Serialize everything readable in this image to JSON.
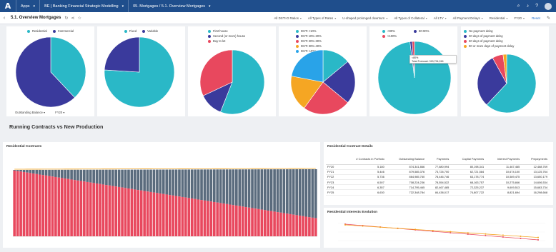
{
  "topbar": {
    "logo": "A",
    "crumbs": [
      {
        "label": "Apps"
      },
      {
        "label": "BE | Banking Financial Strategic Modelling"
      },
      {
        "label": "05. Mortgages / 5.1. Overview Mortgages"
      }
    ],
    "icons": [
      "search-icon",
      "bell-icon",
      "help-icon",
      "avatar"
    ]
  },
  "subbar": {
    "back": "‹",
    "title": "5.1. Overview Mortgages",
    "title_icons": [
      "refresh-icon",
      "share-icon",
      "star-icon"
    ],
    "filters": [
      {
        "label": "All DSTI-D Ratios"
      },
      {
        "label": "All Types of Rates"
      },
      {
        "label": "U-shaped prolonged downturn"
      },
      {
        "label": "All Types of Collateral"
      },
      {
        "label": "All LTV"
      },
      {
        "label": "All Payment Delays"
      },
      {
        "label": "Residential"
      },
      {
        "label": "FY20"
      }
    ],
    "reset": "Reset"
  },
  "pies": [
    {
      "legend": [
        {
          "label": "Residential",
          "color": "#2ab8c7"
        },
        {
          "label": "Commercial",
          "color": "#3a3a9c"
        }
      ],
      "slices": [
        {
          "value": 38,
          "color": "#2ab8c7"
        },
        {
          "value": 62,
          "color": "#3a3a9c"
        }
      ],
      "foot": [
        "Outstanding Balance",
        "FY20"
      ]
    },
    {
      "legend": [
        {
          "label": "Fixed",
          "color": "#2ab8c7"
        },
        {
          "label": "Variable",
          "color": "#3a3a9c"
        }
      ],
      "slices": [
        {
          "value": 76,
          "color": "#2ab8c7"
        },
        {
          "value": 24,
          "color": "#3a3a9c"
        }
      ]
    },
    {
      "legend": [
        {
          "label": "First house",
          "color": "#2ab8c7"
        },
        {
          "label": "Second (or more) house",
          "color": "#3a3a9c"
        },
        {
          "label": "Buy to let",
          "color": "#e8485e"
        }
      ],
      "slices": [
        {
          "value": 56,
          "color": "#2ab8c7"
        },
        {
          "value": 12,
          "color": "#3a3a9c"
        },
        {
          "value": 32,
          "color": "#e8485e"
        }
      ]
    },
    {
      "legend": [
        {
          "label": "DSTI <10%",
          "color": "#2ab8c7"
        },
        {
          "label": "DSTI 10%-20%",
          "color": "#3a3a9c"
        },
        {
          "label": "DSTI 20%-30%",
          "color": "#e8485e"
        },
        {
          "label": "DSTI 30%-40%",
          "color": "#f5a623"
        },
        {
          "label": "DSTI >40%",
          "color": "#29a3e8"
        }
      ],
      "slices": [
        {
          "value": 14,
          "color": "#2ab8c7"
        },
        {
          "value": 22,
          "color": "#3a3a9c"
        },
        {
          "value": 24,
          "color": "#e8485e"
        },
        {
          "value": 18,
          "color": "#f5a623"
        },
        {
          "value": 22,
          "color": "#29a3e8"
        }
      ]
    },
    {
      "legend": [
        {
          "label": "<80%",
          "color": "#2ab8c7"
        },
        {
          "label": "80-90%",
          "color": "#3a3a9c"
        },
        {
          "label": ">100%",
          "color": "#e8485e"
        }
      ],
      "slices": [
        {
          "value": 98,
          "color": "#2ab8c7"
        },
        {
          "value": 1,
          "color": "#3a3a9c"
        },
        {
          "value": 1,
          "color": "#e8485e"
        }
      ]
    },
    {
      "legend": [
        {
          "label": "No payment delay",
          "color": "#2ab8c7"
        },
        {
          "label": "30 days of payment delay",
          "color": "#3a3a9c"
        },
        {
          "label": "60 days of payment delay",
          "color": "#e8485e"
        },
        {
          "label": "90 or more days of payment delay",
          "color": "#f5a623"
        }
      ],
      "slices": [
        {
          "value": 62,
          "color": "#2ab8c7"
        },
        {
          "value": 30,
          "color": "#3a3a9c"
        },
        {
          "value": 6,
          "color": "#e8485e"
        },
        {
          "value": 2,
          "color": "#f5a623"
        }
      ]
    }
  ],
  "tooltip": {
    "line1": "<80%",
    "line2": "Total Forecast: 315,794,916"
  },
  "section_title": "Running Contracts vs New Production",
  "residential_contracts": {
    "title": "Residential Contracts",
    "colors": {
      "red": "#e8485e",
      "slate": "#5a6b7d",
      "line": "#f5a623"
    }
  },
  "details": {
    "title": "Residential Contract Details",
    "headers": [
      "",
      "# Contracts in Portfolio",
      "Outstanding Balance",
      "Payments",
      "Capital Payments",
      "Interest Payments",
      "Prepayments"
    ],
    "rows": [
      [
        "FY20",
        "5,180",
        "874,341,866",
        "77,680,994",
        "80,198,341",
        "11,467,465",
        "12,468,769"
      ],
      [
        "FY21",
        "5,446",
        "879,585,376",
        "73,726,700",
        "62,721,584",
        "10,674,100",
        "13,125,764"
      ],
      [
        "FY22",
        "5,736",
        "864,985,760",
        "78,446,746",
        "63,178,774",
        "10,589,475",
        "13,650,179"
      ],
      [
        "FY23",
        "6,507",
        "708,224,236",
        "78,554,522",
        "68,163,757",
        "10,275,846",
        "14,606,534"
      ],
      [
        "FY24",
        "6,357",
        "714,795,465",
        "82,467,485",
        "72,325,237",
        "9,609,513",
        "15,683,734"
      ],
      [
        "FY25",
        "6,630",
        "722,348,784",
        "84,438,017",
        "74,807,722",
        "8,821,694",
        "16,298,668"
      ]
    ]
  },
  "interests": {
    "title": "Residential Interests Evolution",
    "colors": {
      "a": "#e8485e",
      "b": "#f5a623"
    }
  }
}
